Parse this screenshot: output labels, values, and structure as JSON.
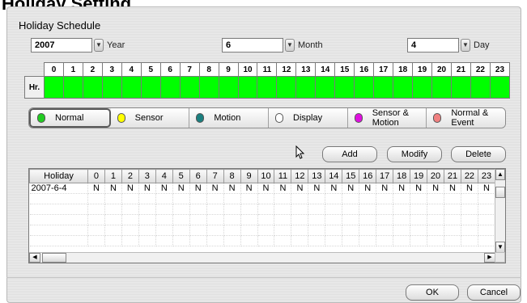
{
  "window": {
    "title": "Holiday Setting"
  },
  "panel": {
    "title": "Holiday Schedule"
  },
  "date": {
    "year": {
      "value": "2007",
      "label": "Year"
    },
    "month": {
      "value": "6",
      "label": "Month"
    },
    "day": {
      "value": "4",
      "label": "Day"
    }
  },
  "hour_grid": {
    "row_label": "Hr.",
    "hours": [
      "0",
      "1",
      "2",
      "3",
      "4",
      "5",
      "6",
      "7",
      "8",
      "9",
      "10",
      "11",
      "12",
      "13",
      "14",
      "15",
      "16",
      "17",
      "18",
      "19",
      "20",
      "21",
      "22",
      "23"
    ],
    "cell_color": "#00ff00"
  },
  "legend": [
    {
      "label": "Normal",
      "color": "#22cc22",
      "active": true
    },
    {
      "label": "Sensor",
      "color": "#ffff00",
      "active": false
    },
    {
      "label": "Motion",
      "color": "#1a7f7f",
      "active": false
    },
    {
      "label": "Display",
      "color": "#ffffff",
      "active": false
    },
    {
      "label": "Sensor & Motion",
      "color": "#e010e0",
      "active": false
    },
    {
      "label": "Normal & Event",
      "color": "#f08080",
      "active": false
    }
  ],
  "actions": {
    "add": "Add",
    "modify": "Modify",
    "delete": "Delete"
  },
  "holiday_list": {
    "first_column": "Holiday",
    "hours": [
      "0",
      "1",
      "2",
      "3",
      "4",
      "5",
      "6",
      "7",
      "8",
      "9",
      "10",
      "11",
      "12",
      "13",
      "14",
      "15",
      "16",
      "17",
      "18",
      "19",
      "20",
      "21",
      "22",
      "23"
    ],
    "rows": [
      {
        "date": "2007-6-4",
        "values": [
          "N",
          "N",
          "N",
          "N",
          "N",
          "N",
          "N",
          "N",
          "N",
          "N",
          "N",
          "N",
          "N",
          "N",
          "N",
          "N",
          "N",
          "N",
          "N",
          "N",
          "N",
          "N",
          "N",
          "N"
        ]
      }
    ]
  },
  "footer": {
    "ok": "OK",
    "cancel": "Cancel"
  },
  "icons": {
    "dropdown": "chevron-down-icon",
    "cursor": "mouse-pointer-icon"
  }
}
